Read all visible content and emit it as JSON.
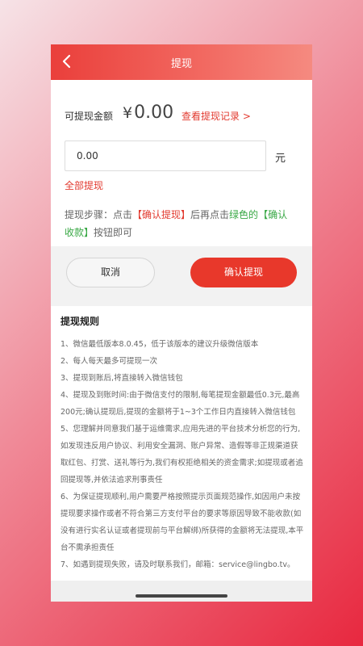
{
  "header": {
    "title": "提现"
  },
  "amount": {
    "label": "可提现金额",
    "currency": "¥",
    "value": "0.00",
    "record_link": "查看提现记录 >"
  },
  "input": {
    "value": "0.00",
    "unit": "元"
  },
  "withdraw_all": "全部提现",
  "steps": {
    "prefix": "提现步骤：点击",
    "confirm_withdraw": "【确认提现】",
    "middle": "后再点击",
    "green_word": "绿色的",
    "confirm_receive": "【确认收款】",
    "suffix": "按钮即可"
  },
  "buttons": {
    "cancel": "取消",
    "confirm": "确认提现"
  },
  "rules": {
    "title": "提现规则",
    "items": [
      "1、微信最低版本8.0.45，低于该版本的建议升级微信版本",
      "2、每人每天最多可提现一次",
      "3、提现到账后,将直接转入微信钱包",
      "4、提现及到账时间:由于微信支付的限制,每笔提现金额最低0.3元,最高200元;确认提现后,提现的金额将于1~3个工作日内直接转入微信钱包",
      "5、您理解并同意我们基于运维需求,应用先进的平台技术分析您的行为,如发现违反用户协议、利用安全漏洞、账户异常、造假等非正规渠道获取红包、打赏、送礼等行为,我们有权拒绝相关的资金需求;如提现或者追回提现等,并依法追求刑事责任",
      "6、为保证提现顺利,用户需要严格按照提示页面规范操作,如因用户未按提现要求操作或者不符合第三方支付平台的要求等原因导致不能收款(如没有进行实名认证或者提现前与平台解绑)所获得的金额将无法提现,本平台不需承担责任",
      "7、如遇到提现失败，请及时联系我们，邮箱：service@lingbo.tv。"
    ]
  },
  "colors": {
    "accent": "#e8382b",
    "green": "#39a845"
  },
  "icons": {
    "back": "chevron-left-icon"
  }
}
